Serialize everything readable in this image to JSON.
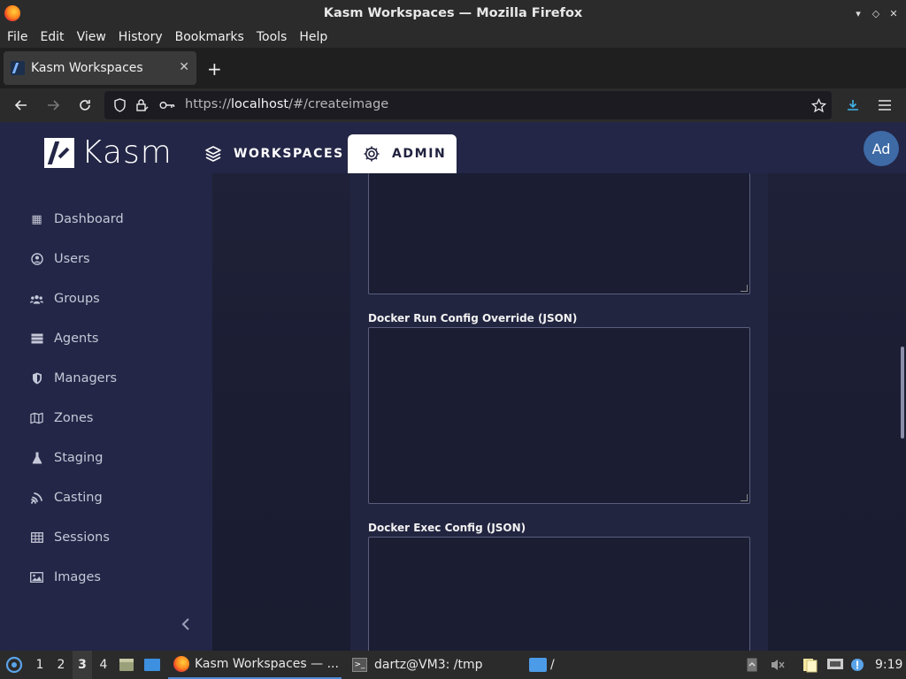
{
  "window": {
    "title": "Kasm Workspaces — Mozilla Firefox"
  },
  "menubar": [
    "File",
    "Edit",
    "View",
    "History",
    "Bookmarks",
    "Tools",
    "Help"
  ],
  "tab": {
    "title": "Kasm Workspaces",
    "close": "✕"
  },
  "newtab": "+",
  "urlbar": {
    "prefix": "https://",
    "host": "localhost",
    "path": "/#/createimage"
  },
  "kasm": {
    "logo_text": "Kasm",
    "nav": {
      "workspaces": "WORKSPACES",
      "admin": "ADMIN"
    },
    "avatar": "Ad",
    "sidebar": [
      {
        "label": "Dashboard",
        "icon": "grid-icon"
      },
      {
        "label": "Users",
        "icon": "user-circle-icon"
      },
      {
        "label": "Groups",
        "icon": "users-icon"
      },
      {
        "label": "Agents",
        "icon": "server-icon"
      },
      {
        "label": "Managers",
        "icon": "shield-icon"
      },
      {
        "label": "Zones",
        "icon": "map-icon"
      },
      {
        "label": "Staging",
        "icon": "flask-icon"
      },
      {
        "label": "Casting",
        "icon": "cast-icon"
      },
      {
        "label": "Sessions",
        "icon": "table-icon"
      },
      {
        "label": "Images",
        "icon": "image-icon"
      }
    ],
    "fields": {
      "docker_run_label": "Docker Run Config Override (JSON)",
      "docker_exec_label": "Docker Exec Config (JSON)"
    }
  },
  "taskbar": {
    "workspaces": [
      "1",
      "2",
      "3",
      "4"
    ],
    "active_workspace": "3",
    "firefox_task": "Kasm Workspaces — ...",
    "terminal_task": "dartz@VM3: /tmp",
    "files_task": "/",
    "clock": "9:19"
  }
}
